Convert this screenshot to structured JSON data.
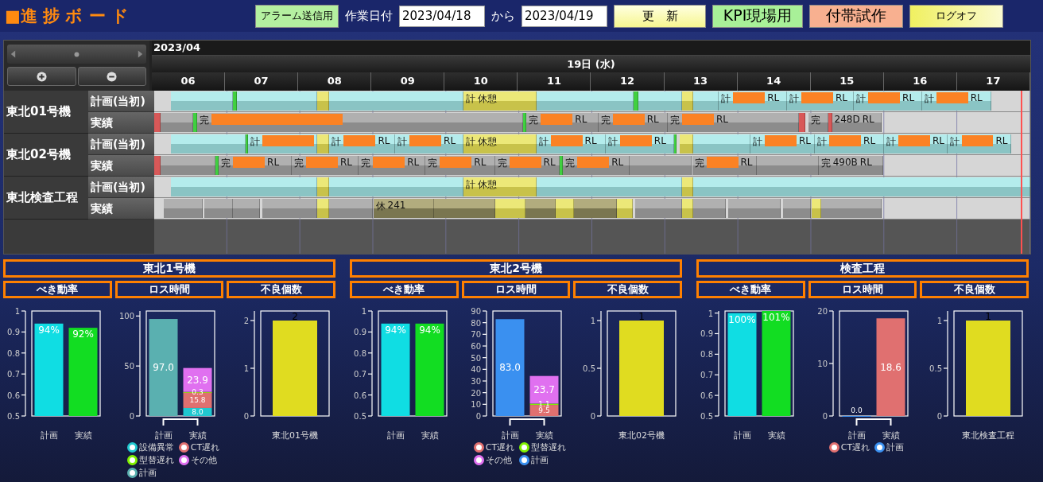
{
  "header": {
    "title": "■進 捗 ボ ー ド",
    "alarm_button": "アラーム送信用",
    "date_label": "作業日付",
    "date_from": "2023/04/18",
    "range_word": "から",
    "date_to": "2023/04/19",
    "buttons": [
      {
        "label": "更　新",
        "kind": "refresh"
      },
      {
        "label": "KPI現場用",
        "kind": "kpi"
      },
      {
        "label": "付帯試作",
        "kind": "trial"
      },
      {
        "label": "ログオフ",
        "kind": "logoff"
      }
    ]
  },
  "gantt": {
    "month": "2023/04",
    "day": "19日 (水)",
    "hours": [
      "06",
      "07",
      "08",
      "09",
      "10",
      "11",
      "12",
      "13",
      "14",
      "15",
      "16",
      "17"
    ],
    "machines": [
      {
        "name": "東北01号機",
        "rows": [
          {
            "label": "計画(当初)",
            "segments": [
              {
                "kind": "plan"
              },
              {
                "kind": "change"
              },
              {
                "kind": "plan"
              },
              {
                "kind": "break"
              },
              {
                "kind": "plan"
              },
              {
                "kind": "break",
                "mark": "計",
                "text": "休憩"
              },
              {
                "kind": "plan"
              },
              {
                "kind": "change"
              },
              {
                "kind": "plan"
              },
              {
                "kind": "break"
              },
              {
                "kind": "plan"
              },
              {
                "kind": "plan",
                "mark": "計",
                "redacted": true,
                "suffix": "RL"
              },
              {
                "kind": "plan",
                "mark": "計",
                "redacted": true,
                "suffix": "RL"
              },
              {
                "kind": "plan",
                "mark": "計",
                "redacted": true,
                "suffix": "RL"
              },
              {
                "kind": "plan",
                "mark": "計",
                "redacted": true,
                "suffix": "RL"
              }
            ]
          },
          {
            "label": "実績",
            "segments": [
              {
                "kind": "stop"
              },
              {
                "kind": "actual"
              },
              {
                "kind": "change"
              },
              {
                "kind": "actual",
                "mark": "完",
                "redacted": true
              },
              {
                "kind": "change"
              },
              {
                "kind": "actual",
                "mark": "完",
                "redacted": true,
                "suffix": "RL"
              },
              {
                "kind": "actual",
                "mark": "完",
                "redacted": true,
                "suffix": "RL"
              },
              {
                "kind": "actual",
                "mark": "完",
                "redacted": true,
                "suffix": "RL"
              },
              {
                "kind": "stop"
              },
              {
                "kind": "actual",
                "mark": "完"
              },
              {
                "kind": "stop"
              },
              {
                "kind": "actual",
                "text": "248D",
                "suffix": "RL"
              }
            ]
          }
        ]
      },
      {
        "name": "東北02号機",
        "rows": [
          {
            "label": "計画(当初)",
            "segments": [
              {
                "kind": "plan"
              },
              {
                "kind": "change"
              },
              {
                "kind": "plan",
                "mark": "計",
                "redacted": true
              },
              {
                "kind": "break"
              },
              {
                "kind": "plan",
                "mark": "計",
                "redacted": true,
                "suffix": "RL"
              },
              {
                "kind": "plan",
                "mark": "計",
                "redacted": true,
                "suffix": "RL"
              },
              {
                "kind": "break",
                "mark": "計",
                "text": "休憩"
              },
              {
                "kind": "plan",
                "mark": "計",
                "redacted": true,
                "suffix": "RL"
              },
              {
                "kind": "plan",
                "mark": "計",
                "redacted": true,
                "suffix": "RL"
              },
              {
                "kind": "change"
              },
              {
                "kind": "break"
              },
              {
                "kind": "plan"
              },
              {
                "kind": "plan",
                "mark": "計",
                "redacted": true,
                "suffix": "RL"
              },
              {
                "kind": "plan",
                "mark": "計",
                "redacted": true,
                "suffix": "RL"
              },
              {
                "kind": "plan",
                "mark": "計",
                "redacted": true,
                "suffix": "RL"
              },
              {
                "kind": "plan",
                "mark": "計",
                "redacted": true,
                "suffix": "RL"
              }
            ]
          },
          {
            "label": "実績",
            "segments": [
              {
                "kind": "stop"
              },
              {
                "kind": "actual"
              },
              {
                "kind": "change"
              },
              {
                "kind": "actual",
                "mark": "完",
                "redacted": true,
                "suffix": "RL"
              },
              {
                "kind": "actual",
                "mark": "完",
                "redacted": true,
                "suffix": "RL"
              },
              {
                "kind": "actual",
                "mark": "完",
                "redacted": true,
                "suffix": "RL"
              },
              {
                "kind": "actual",
                "mark": "完",
                "redacted": true,
                "suffix": "RL"
              },
              {
                "kind": "actual",
                "mark": "完",
                "redacted": true,
                "suffix": "RL"
              },
              {
                "kind": "change"
              },
              {
                "kind": "actual",
                "mark": "完",
                "redacted": true,
                "suffix": "RL"
              },
              {
                "kind": "actual"
              },
              {
                "kind": "actual",
                "mark": "完",
                "redacted": true,
                "suffix": "RL"
              },
              {
                "kind": "actual"
              },
              {
                "kind": "actual",
                "mark": "完",
                "text": "490B",
                "suffix": "RL"
              }
            ]
          }
        ]
      },
      {
        "name": "東北検査工程",
        "rows": [
          {
            "label": "計画(当初)",
            "segments": [
              {
                "kind": "plan"
              },
              {
                "kind": "break"
              },
              {
                "kind": "plan"
              },
              {
                "kind": "break",
                "mark": "計",
                "text": "休憩"
              },
              {
                "kind": "plan"
              },
              {
                "kind": "break"
              },
              {
                "kind": "plan"
              }
            ]
          },
          {
            "label": "実績",
            "segments": [
              {
                "kind": "actual"
              },
              {
                "kind": "actual"
              },
              {
                "kind": "actual"
              },
              {
                "kind": "actual"
              },
              {
                "kind": "break"
              },
              {
                "kind": "actual"
              },
              {
                "kind": "hold",
                "mark": "休",
                "text": "241"
              },
              {
                "kind": "hold"
              },
              {
                "kind": "break"
              },
              {
                "kind": "hold"
              },
              {
                "kind": "break"
              },
              {
                "kind": "hold"
              },
              {
                "kind": "break"
              },
              {
                "kind": "actual"
              },
              {
                "kind": "break"
              },
              {
                "kind": "actual"
              },
              {
                "kind": "actual"
              },
              {
                "kind": "actual"
              },
              {
                "kind": "break"
              },
              {
                "kind": "actual"
              }
            ]
          }
        ]
      }
    ]
  },
  "kpi": [
    {
      "title": "東北1号機",
      "headings": [
        "べき動率",
        "ロス時間",
        "不良個数"
      ],
      "charts": [
        {
          "chart_data": {
            "type": "bar",
            "categories": [
              "計画",
              "実績"
            ],
            "series": [
              {
                "color": "#10dde3",
                "values": [
                  0.94,
                  null
                ]
              },
              {
                "color": "#12dd22",
                "values": [
                  null,
                  0.92
                ]
              }
            ],
            "ylim": [
              0.5,
              1
            ],
            "yticks": [
              0.5,
              0.6,
              0.7,
              0.8,
              0.9,
              1
            ],
            "value_labels": [
              "94%",
              "92%"
            ]
          }
        },
        {
          "chart_data": {
            "type": "bar",
            "stacked": true,
            "categories": [
              "計画",
              "実績"
            ],
            "series": [
              {
                "name": "設備異常",
                "color": "#20c8d0",
                "values": [
                  null,
                  8.0
                ],
                "value_labels": [
                  null,
                  "8.0"
                ]
              },
              {
                "name": "CT遅れ",
                "color": "#e07070",
                "values": [
                  null,
                  15.8
                ],
                "value_labels": [
                  null,
                  "15.8"
                ]
              },
              {
                "name": "型替遅れ",
                "color": "#80f000",
                "values": [
                  null,
                  0.3
                ],
                "value_labels": [
                  null,
                  "0.3"
                ]
              },
              {
                "name": "その他",
                "color": "#e070f0",
                "values": [
                  null,
                  23.9
                ],
                "value_labels": [
                  null,
                  "23.9"
                ]
              },
              {
                "name": "計画",
                "color": "#5ab0b0",
                "values": [
                  97.0,
                  null
                ],
                "value_labels": [
                  "97.0",
                  null
                ]
              }
            ],
            "ylim": [
              0,
              105
            ],
            "yticks": [
              0,
              50,
              100
            ]
          }
        },
        {
          "chart_data": {
            "type": "bar",
            "categories": [
              "東北01号機"
            ],
            "series": [
              {
                "color": "#e0dc20",
                "values": [
                  2
                ]
              }
            ],
            "ylim": [
              0,
              2.2
            ],
            "yticks": [
              0,
              1,
              2
            ],
            "value_labels": [
              "2"
            ]
          }
        }
      ]
    },
    {
      "title": "東北2号機",
      "headings": [
        "べき動率",
        "ロス時間",
        "不良個数"
      ],
      "charts": [
        {
          "chart_data": {
            "type": "bar",
            "categories": [
              "計画",
              "実績"
            ],
            "series": [
              {
                "color": "#10dde3",
                "values": [
                  0.94,
                  null
                ]
              },
              {
                "color": "#12dd22",
                "values": [
                  null,
                  0.94
                ]
              }
            ],
            "ylim": [
              0.5,
              1
            ],
            "yticks": [
              0.5,
              0.6,
              0.7,
              0.8,
              0.9,
              1
            ],
            "value_labels": [
              "94%",
              "94%"
            ]
          }
        },
        {
          "chart_data": {
            "type": "bar",
            "stacked": true,
            "categories": [
              "計画",
              "実績"
            ],
            "series": [
              {
                "name": "CT遅れ",
                "color": "#e07070",
                "values": [
                  null,
                  9.5
                ],
                "value_labels": [
                  null,
                  "9.5"
                ]
              },
              {
                "name": "型替遅れ",
                "color": "#80f000",
                "values": [
                  null,
                  1.1
                ],
                "value_labels": [
                  null,
                  "1.1"
                ]
              },
              {
                "name": "その他",
                "color": "#e070f0",
                "values": [
                  null,
                  23.7
                ],
                "value_labels": [
                  null,
                  "23.7"
                ]
              },
              {
                "name": "計画",
                "color": "#3a90f0",
                "values": [
                  83.0,
                  null
                ],
                "value_labels": [
                  "83.0",
                  null
                ]
              }
            ],
            "ylim": [
              0,
              90
            ],
            "yticks": [
              0,
              10,
              20,
              30,
              40,
              50,
              60,
              70,
              80,
              90
            ]
          }
        },
        {
          "chart_data": {
            "type": "bar",
            "categories": [
              "東北02号機"
            ],
            "series": [
              {
                "color": "#e0dc20",
                "values": [
                  1
                ]
              }
            ],
            "ylim": [
              0,
              1.1
            ],
            "yticks": [
              0,
              0.5,
              1
            ],
            "value_labels": [
              "1"
            ]
          }
        }
      ]
    },
    {
      "title": "検査工程",
      "headings": [
        "べき動率",
        "ロス時間",
        "不良個数"
      ],
      "charts": [
        {
          "chart_data": {
            "type": "bar",
            "categories": [
              "計画",
              "実績"
            ],
            "series": [
              {
                "color": "#10dde3",
                "values": [
                  1.0,
                  null
                ]
              },
              {
                "color": "#12dd22",
                "values": [
                  null,
                  1.01
                ]
              }
            ],
            "ylim": [
              0.5,
              1.01
            ],
            "yticks": [
              0.5,
              0.6,
              0.7,
              0.8,
              0.9,
              1
            ],
            "value_labels": [
              "100%",
              "101%"
            ]
          }
        },
        {
          "chart_data": {
            "type": "bar",
            "stacked": true,
            "categories": [
              "計画",
              "実績"
            ],
            "series": [
              {
                "name": "CT遅れ",
                "color": "#e07070",
                "values": [
                  null,
                  18.6
                ],
                "value_labels": [
                  null,
                  "18.6"
                ]
              },
              {
                "name": "計画",
                "color": "#3a90f0",
                "values": [
                  0.0,
                  null
                ],
                "value_labels": [
                  "0.0",
                  null
                ]
              }
            ],
            "ylim": [
              0,
              20
            ],
            "yticks": [
              0,
              10,
              20
            ]
          }
        },
        {
          "chart_data": {
            "type": "bar",
            "categories": [
              "東北検査工程"
            ],
            "series": [
              {
                "color": "#e0dc20",
                "values": [
                  1
                ]
              }
            ],
            "ylim": [
              0,
              1.1
            ],
            "yticks": [
              0,
              0.5,
              1
            ],
            "value_labels": [
              "1"
            ]
          }
        }
      ]
    }
  ]
}
